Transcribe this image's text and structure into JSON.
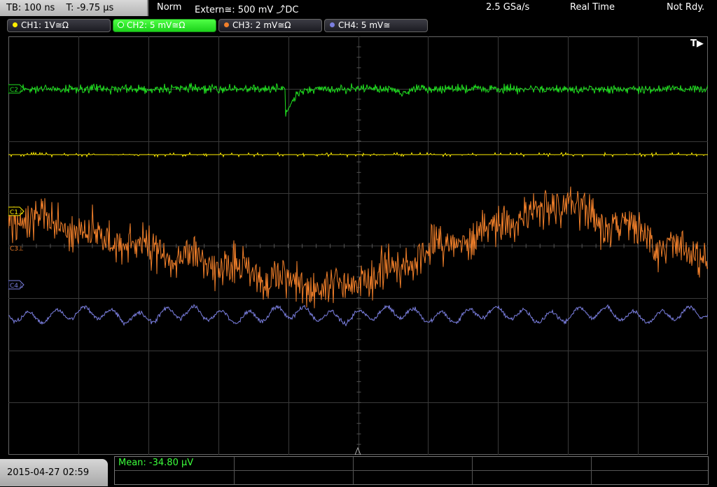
{
  "topbar": {
    "timebase": "TB: 100 ns",
    "trigger_time": "T: -9.75 µs",
    "trigger_mode": "Norm",
    "trigger_source": "Extern≅: 500 mV ⤴DC",
    "sample_rate": "2.5 GSa/s",
    "acq_mode": "Real Time",
    "status": "Not Rdy."
  },
  "channels": [
    {
      "label": "CH1: 1V≅Ω",
      "color": "#ffee00"
    },
    {
      "label": "CH2: 5 mV≅Ω",
      "color": "#20e020"
    },
    {
      "label": "CH3: 2 mV≅Ω",
      "color": "#f07f2a"
    },
    {
      "label": "CH4: 5 mV≅",
      "color": "#7b7fe0"
    }
  ],
  "markers": {
    "ch1": "C1⊥",
    "ch2": "C2⊥",
    "ch3": "C3⊥",
    "ch4": "C4⊥",
    "trigger": "T▶"
  },
  "footer": {
    "datetime": "2015-04-27 02:59",
    "measurement": "Mean: -34.80 µV"
  },
  "colors": {
    "grid": "#3a3a3a",
    "ch1": "#ffee00",
    "ch2": "#20e020",
    "ch3": "#f07f2a",
    "ch4": "#7b7fe0"
  }
}
